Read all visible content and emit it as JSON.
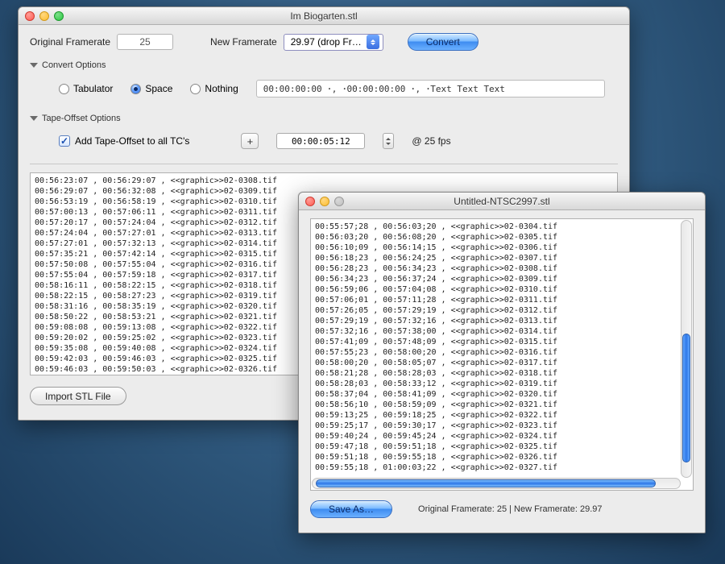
{
  "win1": {
    "title": "Im Biogarten.stl",
    "orig_label": "Original Framerate",
    "orig_value": "25",
    "new_label": "New Framerate",
    "new_value": "29.97 (drop Fr…",
    "convert_label": "Convert",
    "section_convert": "Convert Options",
    "radios": {
      "tab": "Tabulator",
      "space": "Space",
      "nothing": "Nothing"
    },
    "preview_text": "00:00:00:00 ･, ･00:00:00:00 ･, ･Text Text Text",
    "section_offset": "Tape-Offset Options",
    "chk_label": "Add Tape-Offset to all TC's",
    "plus_label": "+",
    "tc_value": "00:00:05:12",
    "fps_label": "@ 25 fps",
    "import_label": "Import STL File",
    "rows": [
      "00:56:23:07 , 00:56:29:07 , <<graphic>>02-0308.tif",
      "00:56:29:07 , 00:56:32:08 , <<graphic>>02-0309.tif",
      "00:56:53:19 , 00:56:58:19 , <<graphic>>02-0310.tif",
      "00:57:00:13 , 00:57:06:11 , <<graphic>>02-0311.tif",
      "00:57:20:17 , 00:57:24:04 , <<graphic>>02-0312.tif",
      "00:57:24:04 , 00:57:27:01 , <<graphic>>02-0313.tif",
      "00:57:27:01 , 00:57:32:13 , <<graphic>>02-0314.tif",
      "00:57:35:21 , 00:57:42:14 , <<graphic>>02-0315.tif",
      "00:57:50:08 , 00:57:55:04 , <<graphic>>02-0316.tif",
      "00:57:55:04 , 00:57:59:18 , <<graphic>>02-0317.tif",
      "00:58:16:11 , 00:58:22:15 , <<graphic>>02-0318.tif",
      "00:58:22:15 , 00:58:27:23 , <<graphic>>02-0319.tif",
      "00:58:31:16 , 00:58:35:19 , <<graphic>>02-0320.tif",
      "00:58:50:22 , 00:58:53:21 , <<graphic>>02-0321.tif",
      "00:59:08:08 , 00:59:13:08 , <<graphic>>02-0322.tif",
      "00:59:20:02 , 00:59:25:02 , <<graphic>>02-0323.tif",
      "00:59:35:08 , 00:59:40:08 , <<graphic>>02-0324.tif",
      "00:59:42:03 , 00:59:46:03 , <<graphic>>02-0325.tif",
      "00:59:46:03 , 00:59:50:03 , <<graphic>>02-0326.tif"
    ]
  },
  "win2": {
    "title": "Untitled-NTSC2997.stl",
    "save_label": "Save As…",
    "status": "Original Framerate: 25 | New Framerate: 29.97",
    "rows": [
      "00:55:57;28 , 00:56:03;20 , <<graphic>>02-0304.tif",
      "00:56:03;20 , 00:56:08;20 , <<graphic>>02-0305.tif",
      "00:56:10;09 , 00:56:14;15 , <<graphic>>02-0306.tif",
      "00:56:18;23 , 00:56:24;25 , <<graphic>>02-0307.tif",
      "00:56:28;23 , 00:56:34;23 , <<graphic>>02-0308.tif",
      "00:56:34;23 , 00:56:37;24 , <<graphic>>02-0309.tif",
      "00:56:59;06 , 00:57:04;08 , <<graphic>>02-0310.tif",
      "00:57:06;01 , 00:57:11;28 , <<graphic>>02-0311.tif",
      "00:57:26;05 , 00:57:29;19 , <<graphic>>02-0312.tif",
      "00:57:29;19 , 00:57:32;16 , <<graphic>>02-0313.tif",
      "00:57:32;16 , 00:57:38;00 , <<graphic>>02-0314.tif",
      "00:57:41;09 , 00:57:48;09 , <<graphic>>02-0315.tif",
      "00:57:55;23 , 00:58:00;20 , <<graphic>>02-0316.tif",
      "00:58:00;20 , 00:58:05;07 , <<graphic>>02-0317.tif",
      "00:58:21;28 , 00:58:28;03 , <<graphic>>02-0318.tif",
      "00:58:28;03 , 00:58:33;12 , <<graphic>>02-0319.tif",
      "00:58:37;04 , 00:58:41;09 , <<graphic>>02-0320.tif",
      "00:58:56;10 , 00:58:59;09 , <<graphic>>02-0321.tif",
      "00:59:13;25 , 00:59:18;25 , <<graphic>>02-0322.tif",
      "00:59:25;17 , 00:59:30;17 , <<graphic>>02-0323.tif",
      "00:59:40;24 , 00:59:45;24 , <<graphic>>02-0324.tif",
      "00:59:47;18 , 00:59:51;18 , <<graphic>>02-0325.tif",
      "00:59:51;18 , 00:59:55;18 , <<graphic>>02-0326.tif",
      "00:59:55;18 , 01:00:03;22 , <<graphic>>02-0327.tif"
    ]
  }
}
